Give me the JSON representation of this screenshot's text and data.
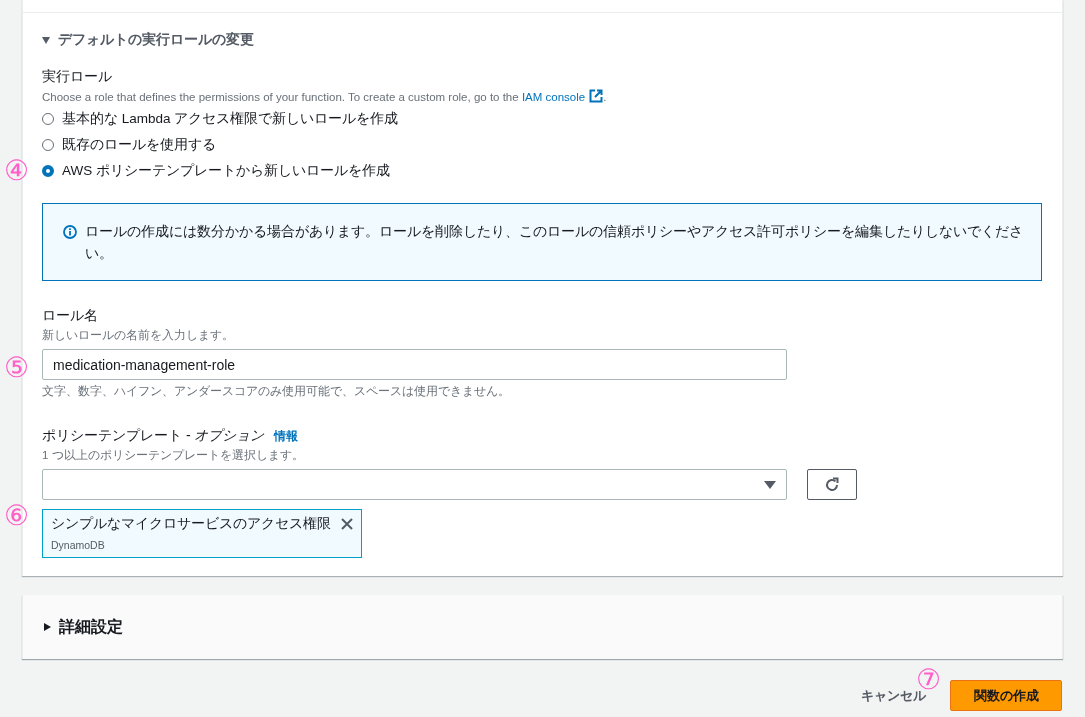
{
  "expander": {
    "label": "デフォルトの実行ロールの変更",
    "expanded": true
  },
  "execution_role": {
    "label": "実行ロール",
    "description": "Choose a role that defines the permissions of your function. To create a custom role, go to the ",
    "link": "IAM console",
    "trailing": ".",
    "annotation": "④",
    "options": [
      {
        "label": "基本的な Lambda アクセス権限で新しいロールを作成",
        "selected": false
      },
      {
        "label": "既存のロールを使用する",
        "selected": false
      },
      {
        "label": "AWS ポリシーテンプレートから新しいロールを作成",
        "selected": true
      }
    ]
  },
  "alert": {
    "text": "ロールの作成には数分かかる場合があります。ロールを削除したり、このロールの信頼ポリシーやアクセス許可ポリシーを編集したりしないでください。"
  },
  "role_name": {
    "label": "ロール名",
    "description": "新しいロールの名前を入力します。",
    "value": "medication-management-role",
    "hint": "文字、数字、ハイフン、アンダースコアのみ使用可能で、スペースは使用できません。",
    "annotation": "⑤"
  },
  "policy_templates": {
    "label": "ポリシーテンプレート - ",
    "label_italic": "オプション",
    "info_link": "情報",
    "description": "1 つ以上のポリシーテンプレートを選択します。",
    "annotation": "⑥",
    "tokens": [
      {
        "label": "シンプルなマイクロサービスのアクセス権限",
        "sublabel": "DynamoDB"
      }
    ]
  },
  "advanced": {
    "label": "詳細設定",
    "expanded": false
  },
  "footer": {
    "cancel": "キャンセル",
    "submit": "関数の作成",
    "annotation": "⑦"
  }
}
